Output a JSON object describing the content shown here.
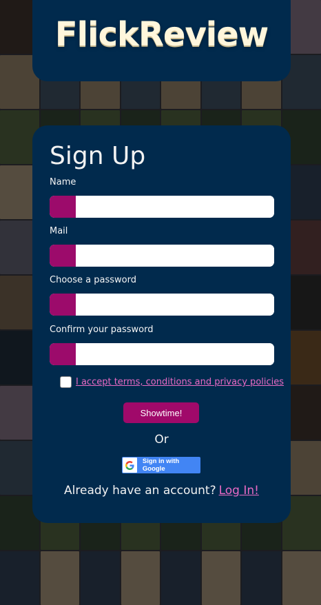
{
  "brand": {
    "title": "FlickReview"
  },
  "form": {
    "title": "Sign Up",
    "fields": [
      {
        "label": "Name",
        "value": "",
        "placeholder": ""
      },
      {
        "label": "Mail",
        "value": "",
        "placeholder": ""
      },
      {
        "label": "Choose a password",
        "value": "",
        "placeholder": ""
      },
      {
        "label": "Confirm your password",
        "value": "",
        "placeholder": ""
      }
    ],
    "terms_label": "I accept terms, conditions and privacy policies",
    "terms_checked": false,
    "submit_label": "Showtime!",
    "or_text": "Or",
    "google_label": "Sign in with Google",
    "login_prompt": "Already have an account?",
    "login_link": "Log In!"
  },
  "colors": {
    "card": "#012a4d",
    "accent": "#9c0b6b",
    "link": "#e96ac4",
    "google": "#4285f4"
  },
  "background": {
    "type": "movie-poster-collage"
  }
}
